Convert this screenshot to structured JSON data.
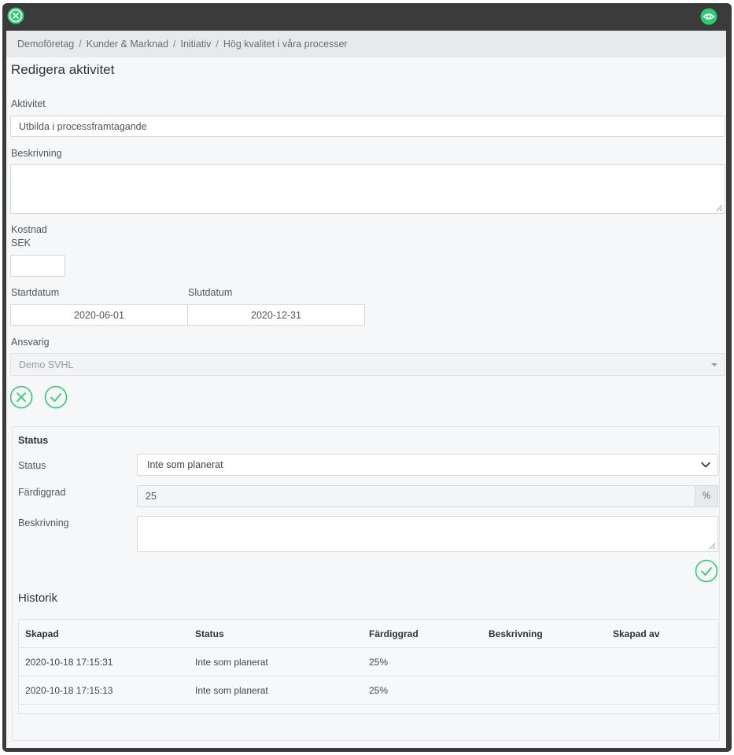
{
  "window": {
    "close_icon": "x-circle-icon",
    "eye_icon": "eye-icon"
  },
  "breadcrumb": [
    "Demoföretag",
    "Kunder & Marknad",
    "Initiativ",
    "Hög kvalitet i våra processer"
  ],
  "form": {
    "title": "Redigera aktivitet",
    "activity_label": "Aktivitet",
    "activity_value": "Utbilda i processframtagande",
    "description_label": "Beskrivning",
    "description_value": "",
    "cost_label": "Kostnad",
    "cost_unit": "SEK",
    "cost_value": "",
    "start_label": "Startdatum",
    "start_value": "2020-06-01",
    "end_label": "Slutdatum",
    "end_value": "2020-12-31",
    "responsible_label": "Ansvarig",
    "responsible_value": "Demo SVHL"
  },
  "status": {
    "title": "Status",
    "status_label": "Status",
    "status_value": "Inte som planerat",
    "completion_label": "Färdiggrad",
    "completion_value": "25",
    "completion_unit": "%",
    "description_label": "Beskrivning",
    "description_value": ""
  },
  "history": {
    "title": "Historik",
    "columns": [
      "Skapad",
      "Status",
      "Färdiggrad",
      "Beskrivning",
      "Skapad av"
    ],
    "rows": [
      [
        "2020-10-18 17:15:31",
        "Inte som planerat",
        "25%",
        "",
        ""
      ],
      [
        "2020-10-18 17:15:13",
        "Inte som planerat",
        "25%",
        "",
        ""
      ]
    ]
  },
  "colors": {
    "accent_green": "#2ecc71",
    "frame": "#3b3b3b",
    "breadcrumb_bg": "#e8e9ea"
  }
}
